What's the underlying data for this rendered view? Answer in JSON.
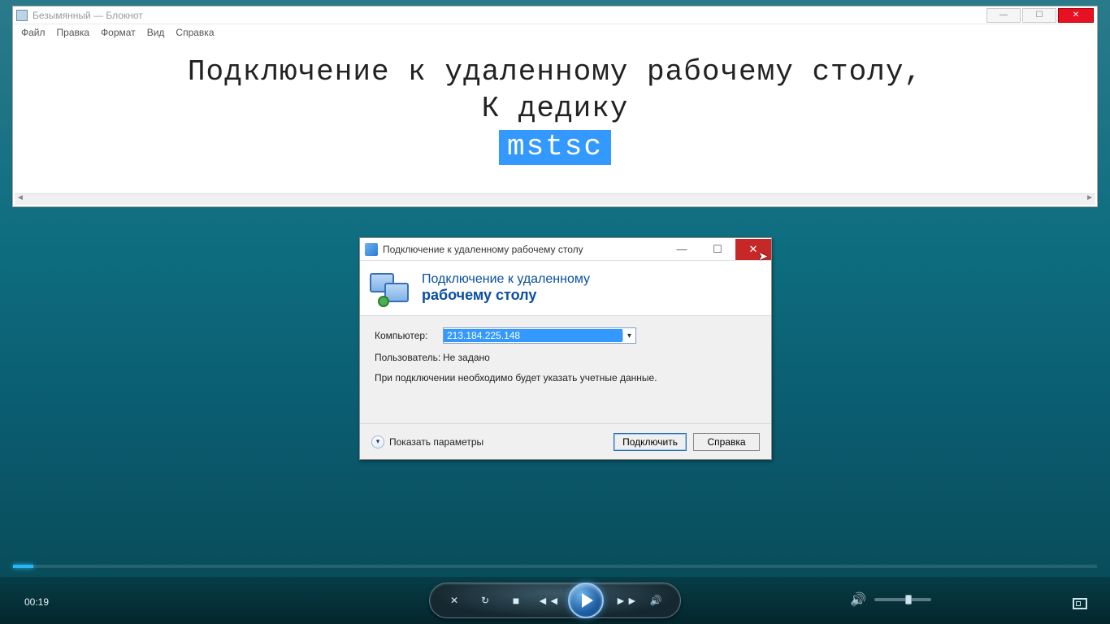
{
  "notepad": {
    "title": "Безымянный — Блокнот",
    "menu": [
      "Файл",
      "Правка",
      "Формат",
      "Вид",
      "Справка"
    ],
    "line1": "Подключение к удаленному рабочему столу,",
    "line2": "К дедику",
    "line3": "mstsc",
    "controls": {
      "min": "—",
      "max": "☐",
      "close": "✕"
    }
  },
  "rdp": {
    "title": "Подключение к удаленному рабочему столу",
    "header_line1": "Подключение к удаленному",
    "header_line2": "рабочему столу",
    "computer_label": "Компьютер:",
    "computer_value": "213.184.225.148",
    "user_label": "Пользователь:",
    "user_value": "Не задано",
    "note": "При подключении необходимо будет указать учетные данные.",
    "expand": "Показать параметры",
    "connect": "Подключить",
    "help": "Справка",
    "controls": {
      "min": "—",
      "max": "☐",
      "close": "✕"
    }
  },
  "player": {
    "time": "00:19"
  }
}
